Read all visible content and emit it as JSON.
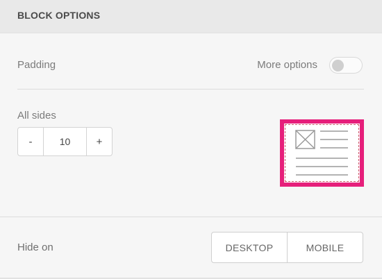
{
  "header": {
    "title": "BLOCK OPTIONS"
  },
  "padding": {
    "label": "Padding",
    "more_options_label": "More options",
    "more_options_enabled": false
  },
  "all_sides": {
    "label": "All sides",
    "decrement_label": "-",
    "value": "10",
    "increment_label": "+"
  },
  "preview": {
    "icon": "layout-thumbnail-icon",
    "highlight_color": "#e61f7b"
  },
  "hide_on": {
    "label": "Hide on",
    "options": [
      "DESKTOP",
      "MOBILE"
    ]
  }
}
